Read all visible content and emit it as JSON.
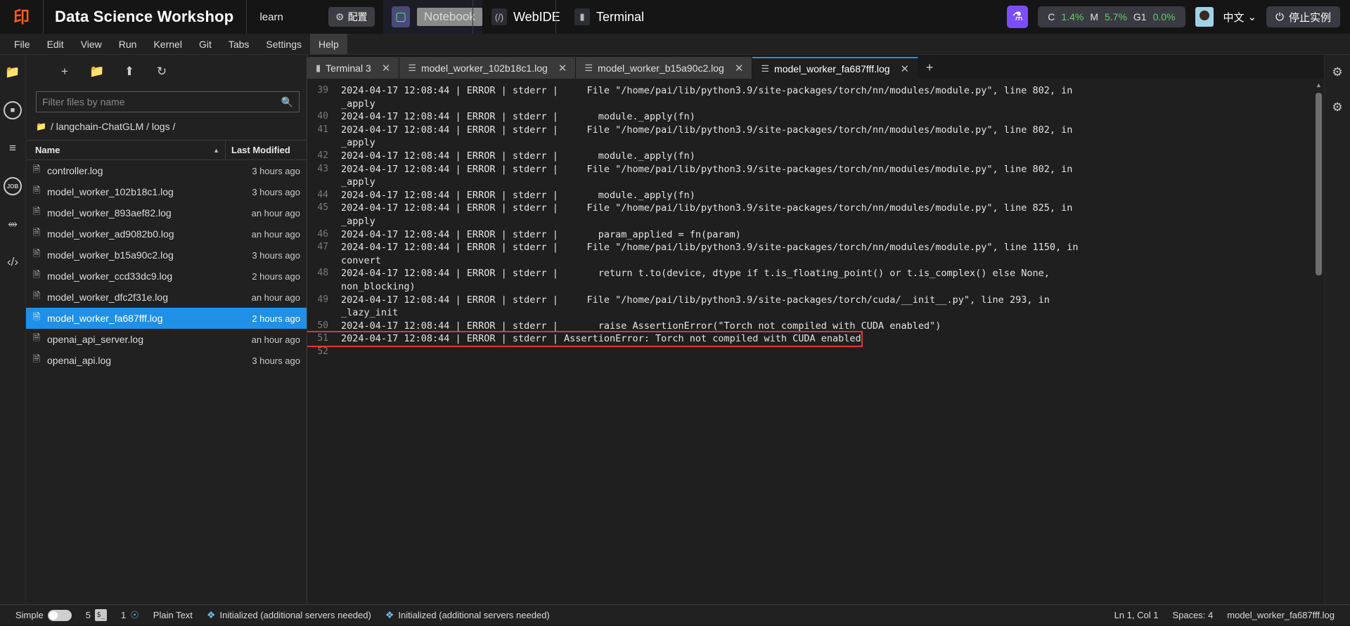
{
  "header": {
    "logo_icon": "pai-logo-icon",
    "app_title": "Data Science Workshop",
    "workspace": "learn",
    "config_button": {
      "icon": "gear-icon",
      "label": "配置"
    },
    "notebook_mode": {
      "icon": "notebook-icon",
      "label": "Notebook"
    },
    "webide": {
      "icon": "webide-icon",
      "label": "WebIDE"
    },
    "terminal": {
      "icon": "terminal-icon",
      "label": "Terminal"
    },
    "flask_icon": "flask-icon",
    "metrics": [
      {
        "key": "C",
        "value": "1.4%"
      },
      {
        "key": "M",
        "value": "5.7%"
      },
      {
        "key": "G1",
        "value": "0.0%"
      }
    ],
    "avatar": "user-avatar",
    "language": {
      "label": "中文",
      "chevron": "⌄"
    },
    "stop_button": {
      "icon": "power-icon",
      "label": "停止实例"
    }
  },
  "menubar": {
    "items": [
      "File",
      "Edit",
      "View",
      "Run",
      "Kernel",
      "Git",
      "Tabs",
      "Settings",
      "Help"
    ],
    "active": "Help"
  },
  "left_rail": [
    {
      "name": "folder-icon",
      "glyph": "▮"
    },
    {
      "name": "running-icon",
      "glyph": "■"
    },
    {
      "name": "toc-icon",
      "glyph": "≡"
    },
    {
      "name": "job-icon",
      "glyph": "JOB"
    },
    {
      "name": "git-icon",
      "glyph": "⤨"
    },
    {
      "name": "extensions-icon",
      "glyph": "‹›"
    }
  ],
  "right_rail": [
    {
      "name": "property-inspector-icon",
      "glyph": "⚙"
    },
    {
      "name": "settings-icon",
      "glyph": "⚙"
    }
  ],
  "browser": {
    "toolbar": [
      {
        "name": "new-folder-root-icon",
        "glyph": "▮"
      },
      {
        "name": "new-launcher-icon",
        "glyph": "+"
      },
      {
        "name": "new-folder-icon",
        "glyph": "▮"
      },
      {
        "name": "upload-icon",
        "glyph": "↑"
      },
      {
        "name": "refresh-icon",
        "glyph": "↻"
      }
    ],
    "filter_placeholder": "Filter files by name",
    "filter_value": "",
    "breadcrumb": "/ langchain-ChatGLM / logs /",
    "columns": {
      "name": "Name",
      "last_modified": "Last Modified"
    },
    "files": [
      {
        "name": "controller.log",
        "modified": "3 hours ago",
        "selected": false
      },
      {
        "name": "model_worker_102b18c1.log",
        "modified": "3 hours ago",
        "selected": false
      },
      {
        "name": "model_worker_893aef82.log",
        "modified": "an hour ago",
        "selected": false
      },
      {
        "name": "model_worker_ad9082b0.log",
        "modified": "an hour ago",
        "selected": false
      },
      {
        "name": "model_worker_b15a90c2.log",
        "modified": "3 hours ago",
        "selected": false
      },
      {
        "name": "model_worker_ccd33dc9.log",
        "modified": "2 hours ago",
        "selected": false
      },
      {
        "name": "model_worker_dfc2f31e.log",
        "modified": "an hour ago",
        "selected": false
      },
      {
        "name": "model_worker_fa687fff.log",
        "modified": "2 hours ago",
        "selected": true
      },
      {
        "name": "openai_api_server.log",
        "modified": "an hour ago",
        "selected": false
      },
      {
        "name": "openai_api.log",
        "modified": "3 hours ago",
        "selected": false
      }
    ]
  },
  "editor": {
    "tabs": [
      {
        "label": "Terminal 3",
        "icon": "terminal-tab-icon",
        "active": false
      },
      {
        "label": "model_worker_102b18c1.log",
        "icon": "file-tab-icon",
        "active": false
      },
      {
        "label": "model_worker_b15a90c2.log",
        "icon": "file-tab-icon",
        "active": false
      },
      {
        "label": "model_worker_fa687fff.log",
        "icon": "file-tab-icon",
        "active": true
      }
    ],
    "add_tab": "+",
    "lines": [
      {
        "num": "39",
        "text": "2024-04-17 12:08:44 | ERROR | stderr |     File \"/home/pai/lib/python3.9/site-packages/torch/nn/modules/module.py\", line 802, in",
        "cont": "_apply",
        "highlight": false
      },
      {
        "num": "40",
        "text": "2024-04-17 12:08:44 | ERROR | stderr |       module._apply(fn)",
        "cont": null,
        "highlight": false
      },
      {
        "num": "41",
        "text": "2024-04-17 12:08:44 | ERROR | stderr |     File \"/home/pai/lib/python3.9/site-packages/torch/nn/modules/module.py\", line 802, in",
        "cont": "_apply",
        "highlight": false
      },
      {
        "num": "42",
        "text": "2024-04-17 12:08:44 | ERROR | stderr |       module._apply(fn)",
        "cont": null,
        "highlight": false
      },
      {
        "num": "43",
        "text": "2024-04-17 12:08:44 | ERROR | stderr |     File \"/home/pai/lib/python3.9/site-packages/torch/nn/modules/module.py\", line 802, in",
        "cont": "_apply",
        "highlight": false
      },
      {
        "num": "44",
        "text": "2024-04-17 12:08:44 | ERROR | stderr |       module._apply(fn)",
        "cont": null,
        "highlight": false
      },
      {
        "num": "45",
        "text": "2024-04-17 12:08:44 | ERROR | stderr |     File \"/home/pai/lib/python3.9/site-packages/torch/nn/modules/module.py\", line 825, in",
        "cont": "_apply",
        "highlight": false
      },
      {
        "num": "46",
        "text": "2024-04-17 12:08:44 | ERROR | stderr |       param_applied = fn(param)",
        "cont": null,
        "highlight": false
      },
      {
        "num": "47",
        "text": "2024-04-17 12:08:44 | ERROR | stderr |     File \"/home/pai/lib/python3.9/site-packages/torch/nn/modules/module.py\", line 1150, in",
        "cont": "convert",
        "highlight": false
      },
      {
        "num": "48",
        "text": "2024-04-17 12:08:44 | ERROR | stderr |       return t.to(device, dtype if t.is_floating_point() or t.is_complex() else None,",
        "cont": "non_blocking)",
        "highlight": false
      },
      {
        "num": "49",
        "text": "2024-04-17 12:08:44 | ERROR | stderr |     File \"/home/pai/lib/python3.9/site-packages/torch/cuda/__init__.py\", line 293, in",
        "cont": "_lazy_init",
        "highlight": false
      },
      {
        "num": "50",
        "text": "2024-04-17 12:08:44 | ERROR | stderr |       raise AssertionError(\"Torch not compiled with CUDA enabled\")",
        "cont": null,
        "highlight": false
      },
      {
        "num": "51",
        "text": "2024-04-17 12:08:44 | ERROR | stderr | AssertionError: Torch not compiled with CUDA enabled",
        "cont": null,
        "highlight": true
      },
      {
        "num": "52",
        "text": "",
        "cont": null,
        "highlight": false
      }
    ]
  },
  "statusbar": {
    "mode_label": "Simple",
    "terminals_count": "5",
    "shell_badge": "$_",
    "kernels_count": "1",
    "kernel_icon": "globe-icon",
    "file_type": "Plain Text",
    "lsp_left": "Initialized (additional servers needed)",
    "lsp_right": "Initialized (additional servers needed)",
    "cursor": "Ln 1, Col 1",
    "spaces": "Spaces: 4",
    "filename": "model_worker_fa687fff.log"
  },
  "colors": {
    "accent": "#1e90e8",
    "error_box": "#e03535",
    "metric_green": "#5fcf68",
    "logo_orange": "#ff5c1a"
  }
}
